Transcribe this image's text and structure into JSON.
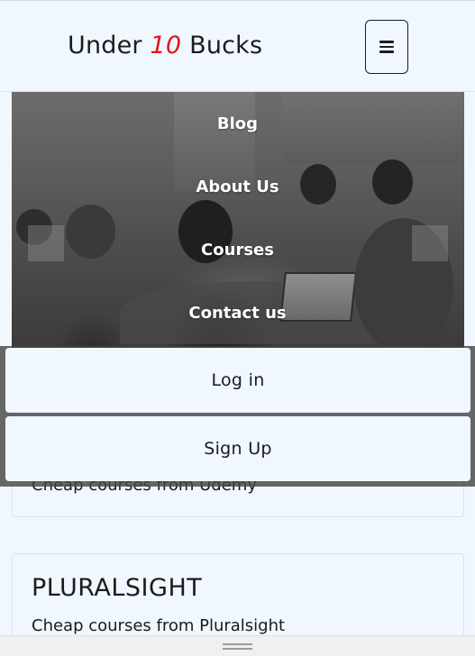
{
  "header": {
    "brand_prefix": "Under",
    "brand_number": "10",
    "brand_suffix": "Bucks",
    "menu_icon": "hamburger-icon"
  },
  "nav": {
    "items": [
      {
        "label": "Blog"
      },
      {
        "label": "About Us"
      },
      {
        "label": "Courses"
      },
      {
        "label": "Contact us"
      }
    ]
  },
  "auth": {
    "login_label": "Log in",
    "signup_label": "Sign Up"
  },
  "cards": {
    "udemy": {
      "desc": "Cheap courses from Udemy"
    },
    "pluralsight": {
      "title": "PLURALSIGHT",
      "desc": "Cheap courses from Pluralsight"
    }
  },
  "colors": {
    "background": "#f0f7ff",
    "accent_number": "#e0161b",
    "overlay": "#464646"
  }
}
